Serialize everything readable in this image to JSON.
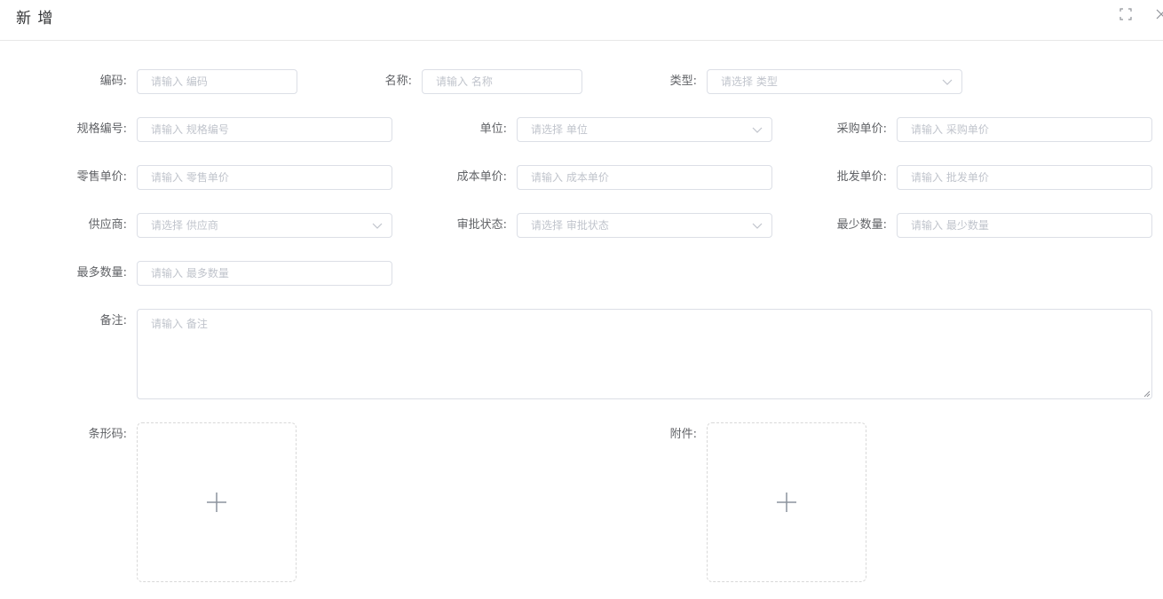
{
  "dialog": {
    "title": "新 增"
  },
  "form": {
    "code": {
      "label": "编码:",
      "placeholder": "请输入 编码"
    },
    "name": {
      "label": "名称:",
      "placeholder": "请输入 名称"
    },
    "type": {
      "label": "类型:",
      "placeholder": "请选择 类型"
    },
    "spec_code": {
      "label": "规格编号:",
      "placeholder": "请输入 规格编号"
    },
    "unit": {
      "label": "单位:",
      "placeholder": "请选择 单位"
    },
    "purchase_price": {
      "label": "采购单价:",
      "placeholder": "请输入 采购单价"
    },
    "retail_price": {
      "label": "零售单价:",
      "placeholder": "请输入 零售单价"
    },
    "cost_price": {
      "label": "成本单价:",
      "placeholder": "请输入 成本单价"
    },
    "wholesale_price": {
      "label": "批发单价:",
      "placeholder": "请输入 批发单价"
    },
    "supplier": {
      "label": "供应商:",
      "placeholder": "请选择 供应商"
    },
    "approval_status": {
      "label": "审批状态:",
      "placeholder": "请选择 审批状态"
    },
    "min_quantity": {
      "label": "最少数量:",
      "placeholder": "请输入 最少数量"
    },
    "max_quantity": {
      "label": "最多数量:",
      "placeholder": "请输入 最多数量"
    },
    "remark": {
      "label": "备注:",
      "placeholder": "请输入 备注"
    },
    "barcode": {
      "label": "条形码:"
    },
    "attachment": {
      "label": "附件:"
    }
  },
  "icons": {
    "fullscreen": "fullscreen-icon",
    "close": "close-icon",
    "chevron": "chevron-down-icon",
    "plus": "plus-icon"
  },
  "colors": {
    "border": "#dcdfe6",
    "placeholder": "#c0c4cc",
    "label": "#606266",
    "title": "#303133",
    "upload_border": "#d9d9d9"
  }
}
